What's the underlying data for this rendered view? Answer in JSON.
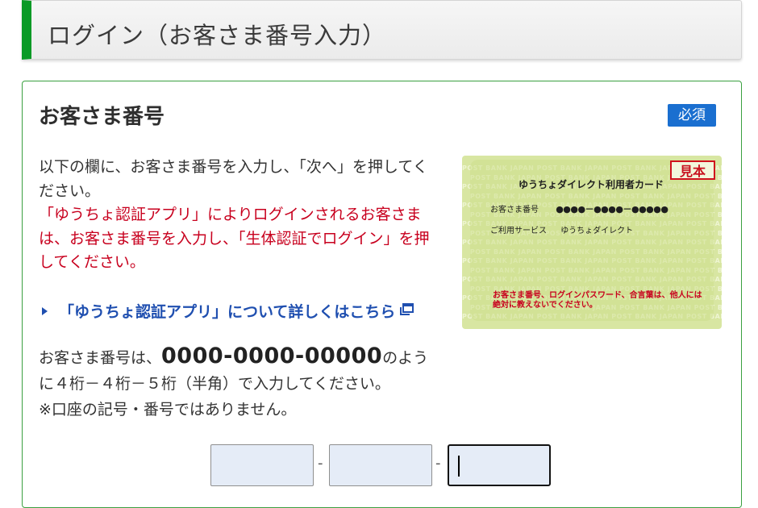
{
  "header": {
    "title": "ログイン（お客さま番号入力）"
  },
  "section": {
    "title": "お客さま番号",
    "required_badge": "必須"
  },
  "instructions": {
    "line1": "以下の欄に、お客さま番号を入力し、「次へ」を押してください。",
    "line2_red": "「ゆうちょ認証アプリ」によりログインされるお客さまは、お客さま番号を入力し、「生体認証でログイン」を押してください。"
  },
  "app_link": {
    "label": "「ゆうちょ認証アプリ」について詳しくはこちら"
  },
  "format_note": {
    "prefix": "お客さま番号は、",
    "example": "0000-0000-00000",
    "suffix": "のように４桁－４桁－５桁（半角）で入力してください。",
    "note": "※口座の記号・番号ではありません。"
  },
  "sample_card": {
    "stamp": "見本",
    "card_name": "ゆうちょダイレクト利用者カード",
    "row1_label": "お客さま番号",
    "row1_value": "●●●●－●●●●－●●●●●",
    "row2_label": "ご利用サービス",
    "row2_value": "ゆうちょダイレクト",
    "warning": "お客さま番号、ログインパスワード、合言葉は、他人には絶対に教えないでください。",
    "background_text": "POST BANK JAPAN POST BANK JAPAN POST BANK JAPAN POST BANK JAPAN"
  },
  "inputs": [
    {
      "value": "",
      "focused": false
    },
    {
      "value": "",
      "focused": false
    },
    {
      "value": "",
      "focused": true
    }
  ],
  "separator": "-",
  "colors": {
    "accent_green": "#0a9a26",
    "badge_blue": "#1a6fd0",
    "warning_red": "#c8001e",
    "link_blue": "#1f4fb0",
    "input_bg": "#e5ecf7"
  }
}
